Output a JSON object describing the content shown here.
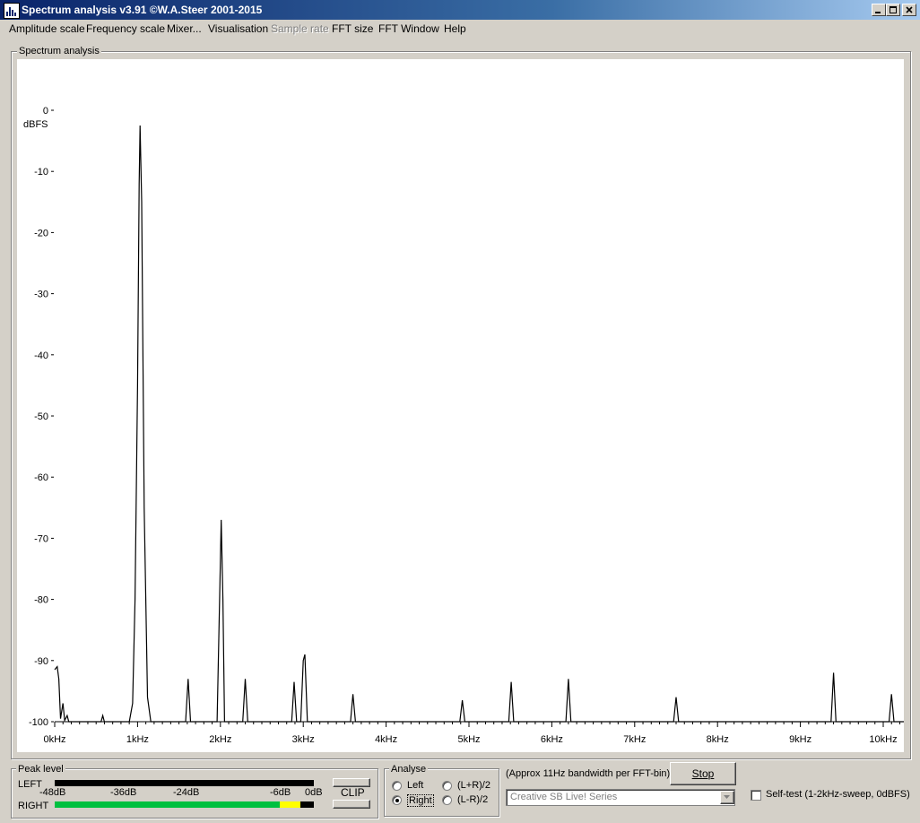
{
  "window": {
    "title": "Spectrum analysis v3.91  ©W.A.Steer 2001-2015"
  },
  "menu": {
    "items": [
      {
        "label": "Amplitude scale",
        "enabled": true
      },
      {
        "label": "Frequency scale",
        "enabled": true
      },
      {
        "label": "Mixer...",
        "enabled": true
      },
      {
        "label": "Visualisation",
        "enabled": true
      },
      {
        "label": "Sample rate",
        "enabled": false
      },
      {
        "label": "FFT size",
        "enabled": true
      },
      {
        "label": "FFT Window",
        "enabled": true
      },
      {
        "label": "Help",
        "enabled": true
      }
    ]
  },
  "spectrum": {
    "group_label": "Spectrum analysis"
  },
  "chart_data": {
    "type": "line",
    "ylabel": "dBFS",
    "ylim": [
      -100,
      0
    ],
    "y_ticks": [
      0,
      -10,
      -20,
      -30,
      -40,
      -50,
      -60,
      -70,
      -80,
      -90,
      -100
    ],
    "y_tick_labels": [
      "0",
      "-10",
      "-20",
      "-30",
      "-40",
      "-50",
      "-60",
      "-70",
      "-80",
      "-90",
      "-100"
    ],
    "xlim": [
      0,
      10.3
    ],
    "x_ticks": [
      0,
      1,
      2,
      3,
      4,
      5,
      6,
      7,
      8,
      9,
      10
    ],
    "x_tick_labels": [
      "0kHz",
      "1kHz",
      "2kHz",
      "3kHz",
      "4kHz",
      "5kHz",
      "6kHz",
      "7kHz",
      "8kHz",
      "9kHz",
      "10kHz"
    ],
    "x_unit": "kHz",
    "grid": false,
    "series": [
      {
        "color": "#000000",
        "points": [
          [
            0.0,
            -91.5
          ],
          [
            0.03,
            -91.0
          ],
          [
            0.05,
            -93.0
          ],
          [
            0.07,
            -99.5
          ],
          [
            0.1,
            -97.0
          ],
          [
            0.12,
            -99.8
          ],
          [
            0.15,
            -99.0
          ],
          [
            0.17,
            -100
          ],
          [
            0.56,
            -100
          ],
          [
            0.58,
            -99.0
          ],
          [
            0.6,
            -100
          ],
          [
            0.9,
            -100
          ],
          [
            0.94,
            -97.0
          ],
          [
            0.97,
            -80.0
          ],
          [
            1.0,
            -45.0
          ],
          [
            1.02,
            -12.0
          ],
          [
            1.03,
            -2.5
          ],
          [
            1.05,
            -15.0
          ],
          [
            1.08,
            -65.0
          ],
          [
            1.12,
            -96.0
          ],
          [
            1.16,
            -100
          ],
          [
            1.58,
            -100
          ],
          [
            1.61,
            -93.0
          ],
          [
            1.64,
            -100
          ],
          [
            1.96,
            -100
          ],
          [
            1.99,
            -80.0
          ],
          [
            2.01,
            -67.0
          ],
          [
            2.03,
            -80.0
          ],
          [
            2.05,
            -100
          ],
          [
            2.27,
            -100
          ],
          [
            2.3,
            -93.0
          ],
          [
            2.33,
            -100
          ],
          [
            2.86,
            -100
          ],
          [
            2.89,
            -93.5
          ],
          [
            2.92,
            -100
          ],
          [
            2.97,
            -100
          ],
          [
            3.0,
            -90.0
          ],
          [
            3.02,
            -89.0
          ],
          [
            3.05,
            -100
          ],
          [
            3.57,
            -100
          ],
          [
            3.6,
            -95.5
          ],
          [
            3.63,
            -100
          ],
          [
            4.89,
            -100
          ],
          [
            4.92,
            -96.5
          ],
          [
            4.95,
            -100
          ],
          [
            5.48,
            -100
          ],
          [
            5.51,
            -93.5
          ],
          [
            5.54,
            -100
          ],
          [
            6.17,
            -100
          ],
          [
            6.2,
            -93.0
          ],
          [
            6.23,
            -100
          ],
          [
            7.47,
            -100
          ],
          [
            7.5,
            -96.0
          ],
          [
            7.53,
            -100
          ],
          [
            9.37,
            -100
          ],
          [
            9.4,
            -92.0
          ],
          [
            9.43,
            -100
          ],
          [
            10.07,
            -100
          ],
          [
            10.1,
            -95.5
          ],
          [
            10.13,
            -100
          ],
          [
            10.3,
            -100
          ]
        ]
      }
    ]
  },
  "peak": {
    "group_label": "Peak level",
    "left_label": "LEFT",
    "right_label": "RIGHT",
    "scale": [
      "-48dB",
      "-36dB",
      "-24dB",
      "-6dB",
      "0dB"
    ],
    "left_level": 0,
    "right_level_fraction": 0.88,
    "green_color": "#00c040",
    "yellow_color": "#ffff00",
    "clip_label": "CLIP"
  },
  "analyse": {
    "group_label": "Analyse",
    "options": [
      {
        "label": "Left",
        "checked": false
      },
      {
        "label": "Right",
        "checked": true
      },
      {
        "label": "(L+R)/2",
        "checked": false
      },
      {
        "label": "(L-R)/2",
        "checked": false
      }
    ]
  },
  "bandwidth_text": "(Approx 11Hz bandwidth per FFT-bin)",
  "stop_label": "Stop",
  "device": {
    "selected": "Creative SB Live! Series"
  },
  "selftest": {
    "label": "Self-test  (1-2kHz-sweep, 0dBFS)",
    "checked": false
  }
}
